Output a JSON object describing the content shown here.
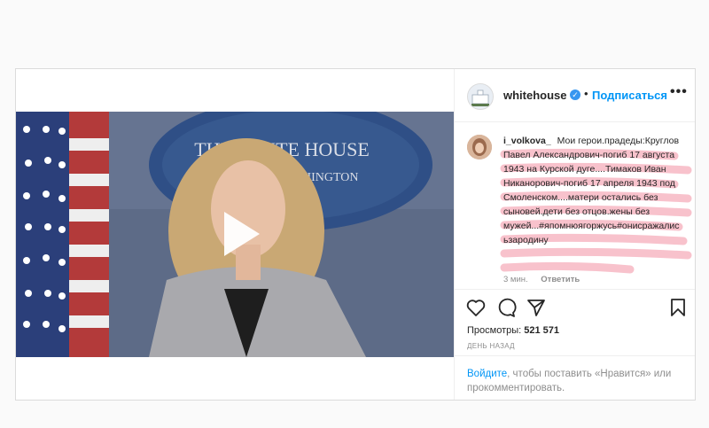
{
  "post": {
    "username": "whitehouse",
    "verified_glyph": "✓",
    "separator": "•",
    "follow_label": "Подписаться",
    "more_label": "•••",
    "video": {
      "seal_text": "THE WHITE HOUSE",
      "seal_subtext": "WASHINGTON"
    }
  },
  "comment": {
    "username": "i_volkova_",
    "text": "Мои герои.прадеды:Круглов Павел Александрович-погиб 17 августа 1943 на Курской дуге....Тимаков Иван Никанорович-погиб 17 апреля 1943 под Смоленском....матери остались без сыновей.дети без отцов.жены без мужей...#япомнюягоржусь#онисражалисьзародину",
    "time": "3 мин.",
    "reply_label": "Ответить",
    "highlight_color": "#f7b8c4"
  },
  "actions": {
    "like_icon": "heart-icon",
    "comment_icon": "comment-icon",
    "share_icon": "share-icon",
    "save_icon": "bookmark-icon"
  },
  "stats": {
    "views_label": "Просмотры:",
    "views_value": "521 571",
    "time_ago": "ДЕНЬ НАЗАД"
  },
  "login": {
    "link": "Войдите",
    "rest": ", чтобы поставить «Нравится» или прокомментировать."
  }
}
